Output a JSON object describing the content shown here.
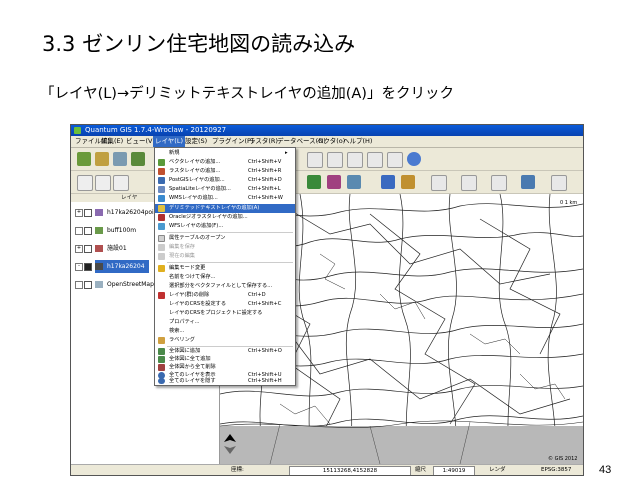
{
  "slide": {
    "title": "3.3 ゼンリン住宅地図の読み込み",
    "instruction": "「レイヤ(L)→デリミットテキストレイヤの追加(A)」をクリック",
    "page_number": "43"
  },
  "window": {
    "title": "Quantum GIS 1.7.4-Wroclaw - 20120927"
  },
  "menubar": {
    "items": [
      "ファイル(F)",
      "編集(E)",
      "ビュー(V)",
      "レイヤ(L)",
      "設定(S)",
      "プラグイン(P)",
      "ラスタ(R)",
      "データベース(D)",
      "ベクタ(o)",
      "ヘルプ(H)"
    ],
    "active_index": 3
  },
  "legend": {
    "header": "レイヤ",
    "layers": [
      {
        "name": "h17ka26204point",
        "checked": false,
        "expanded": "+",
        "selected": false
      },
      {
        "name": "buff100m",
        "checked": false,
        "expanded": "",
        "selected": false
      },
      {
        "name": "施設01",
        "checked": false,
        "expanded": "+",
        "selected": false
      },
      {
        "name": "h17ka26204",
        "checked": true,
        "expanded": "-",
        "selected": true
      },
      {
        "name": "OpenStreetMap",
        "checked": false,
        "expanded": "",
        "selected": false
      }
    ]
  },
  "layer_menu": {
    "items": [
      {
        "label": "新規",
        "shortcut": "",
        "icon": "new-icon",
        "color": "#ffffff",
        "disabled": false,
        "highlighted": false
      },
      {
        "label": "ベクタレイヤの追加...",
        "shortcut": "Ctrl+Shift+V",
        "icon": "vector-icon",
        "color": "#5a9a3a",
        "disabled": false,
        "highlighted": false
      },
      {
        "label": "ラスタレイヤの追加...",
        "shortcut": "Ctrl+Shift+R",
        "icon": "raster-icon",
        "color": "#c05030",
        "disabled": false,
        "highlighted": false
      },
      {
        "label": "PostGISレイヤの追加...",
        "shortcut": "Ctrl+Shift+D",
        "icon": "postgis-icon",
        "color": "#3a6ab0",
        "disabled": false,
        "highlighted": false
      },
      {
        "label": "SpatiaLiteレイヤの追加...",
        "shortcut": "Ctrl+Shift+L",
        "icon": "spatialite-icon",
        "color": "#6a8ac0",
        "disabled": false,
        "highlighted": false
      },
      {
        "label": "WMSレイヤの追加...",
        "shortcut": "Ctrl+Shift+W",
        "icon": "wms-icon",
        "color": "#3a8ad0",
        "disabled": false,
        "highlighted": false
      },
      {
        "label": "デリミテッドテキストレイヤの追加(A)",
        "shortcut": "",
        "icon": "delimited-text-icon",
        "color": "#e0c040",
        "disabled": false,
        "highlighted": true
      },
      {
        "label": "Oracleジオラスタレイヤの追加...",
        "shortcut": "",
        "icon": "oracle-icon",
        "color": "#b03030",
        "disabled": false,
        "highlighted": false
      },
      {
        "label": "WFSレイヤの追加(F)...",
        "shortcut": "",
        "icon": "wfs-icon",
        "color": "#4a9ad0",
        "disabled": false,
        "highlighted": false
      },
      {
        "label": "属性テーブルのオープン",
        "shortcut": "",
        "icon": "table-icon",
        "color": "#d0d0d0",
        "disabled": false,
        "highlighted": false
      },
      {
        "label": "編集を保存",
        "shortcut": "",
        "icon": "save-edits-icon",
        "color": "#cccccc",
        "disabled": true,
        "highlighted": false
      },
      {
        "label": "現在の編集",
        "shortcut": "",
        "icon": "current-edits-icon",
        "color": "#cccccc",
        "disabled": true,
        "highlighted": false
      },
      {
        "label": "編集モード変更",
        "shortcut": "",
        "icon": "edit-mode-icon",
        "color": "#e0b020",
        "disabled": false,
        "highlighted": false
      },
      {
        "label": "名前をつけて保存...",
        "shortcut": "",
        "icon": "",
        "color": "",
        "disabled": false,
        "highlighted": false
      },
      {
        "label": "選択部分をベクタファイルとして保存する...",
        "shortcut": "",
        "icon": "",
        "color": "",
        "disabled": false,
        "highlighted": false
      },
      {
        "label": "レイヤ(群)の削除",
        "shortcut": "Ctrl+D",
        "icon": "remove-layer-icon",
        "color": "#c03030",
        "disabled": false,
        "highlighted": false
      },
      {
        "label": "レイヤのCRSを設定する",
        "shortcut": "Ctrl+Shift+C",
        "icon": "",
        "color": "",
        "disabled": false,
        "highlighted": false
      },
      {
        "label": "レイヤのCRSをプロジェクトに設定する",
        "shortcut": "",
        "icon": "",
        "color": "",
        "disabled": false,
        "highlighted": false
      },
      {
        "label": "プロパティ...",
        "shortcut": "",
        "icon": "",
        "color": "",
        "disabled": false,
        "highlighted": false
      },
      {
        "label": "検索...",
        "shortcut": "",
        "icon": "",
        "color": "",
        "disabled": false,
        "highlighted": false
      },
      {
        "label": "ラベリング",
        "shortcut": "",
        "icon": "labeling-icon",
        "color": "#d0a040",
        "disabled": false,
        "highlighted": false
      },
      {
        "label": "全体図に追加",
        "shortcut": "Ctrl+Shift+O",
        "icon": "overview-add-icon",
        "color": "#4a8a4a",
        "disabled": false,
        "highlighted": false
      },
      {
        "label": "全体図に全て追加",
        "shortcut": "",
        "icon": "overview-add-all-icon",
        "color": "#4a8a4a",
        "disabled": false,
        "highlighted": false
      },
      {
        "label": "全体図から全て削除",
        "shortcut": "",
        "icon": "overview-remove-all-icon",
        "color": "#a04040",
        "disabled": false,
        "highlighted": false
      },
      {
        "label": "全てのレイヤを表示",
        "shortcut": "Ctrl+Shift+U",
        "icon": "show-all-icon",
        "color": "#3a6ab0",
        "disabled": false,
        "highlighted": false
      },
      {
        "label": "全てのレイヤを隠す",
        "shortcut": "Ctrl+Shift+H",
        "icon": "hide-all-icon",
        "color": "#3a6ab0",
        "disabled": false,
        "highlighted": false
      }
    ]
  },
  "statusbar": {
    "coord_label": "座標:",
    "coordinates": "15113268,4152828",
    "scale_label": "縮尺",
    "scale": "1:49019",
    "render_label": "レンダ",
    "epsg": "EPSG:3857"
  },
  "map": {
    "scale_text": "0 1 km",
    "attribution": "© GIS 2012"
  }
}
